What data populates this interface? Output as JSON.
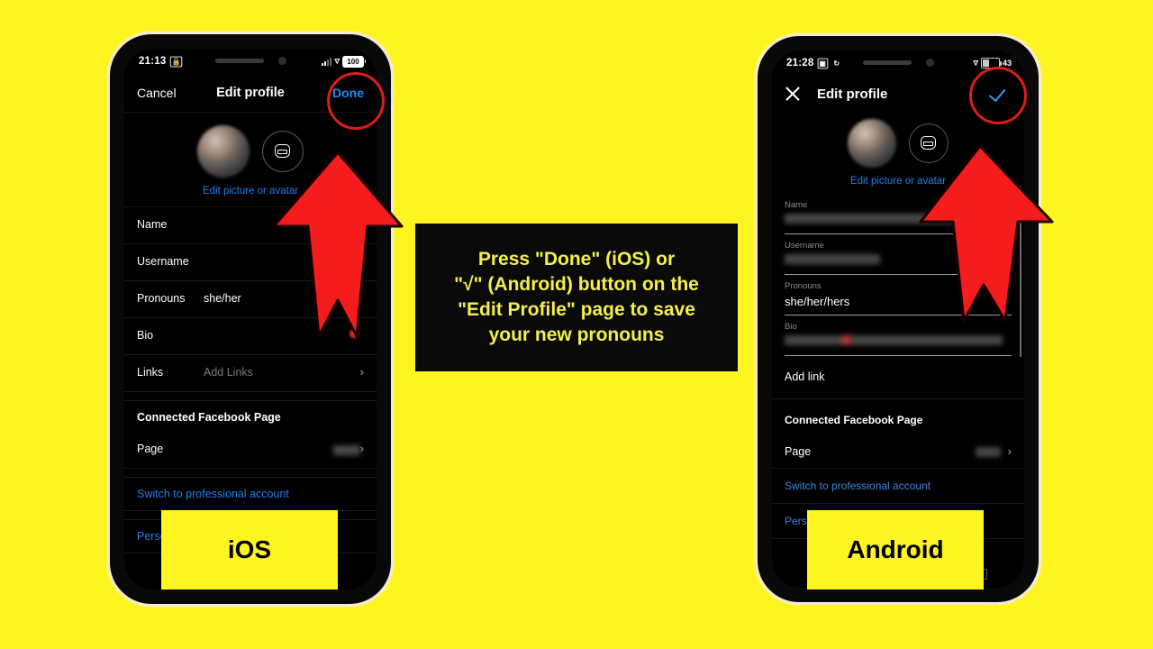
{
  "background_color": "#FDF420",
  "caption": {
    "text": "Press \"Done\" (iOS) or\n\"√\" (Android) button on the\n\"Edit Profile\" page to save\nyour new pronouns",
    "text_color": "#F5EF4A",
    "background_color": "#0A0A0A"
  },
  "annotation": {
    "highlight_color": "#E01B1B",
    "ios_highlight_target": "Done",
    "android_highlight_target": "checkmark"
  },
  "ios": {
    "platform_label": "iOS",
    "statusbar": {
      "time": "21:13",
      "lock_icon": "lock-icon",
      "signal_icon": "cellular-signal-icon",
      "wifi_icon": "wifi-icon",
      "battery": "100"
    },
    "navbar": {
      "cancel_label": "Cancel",
      "title": "Edit profile",
      "done_label": "Done",
      "done_color": "#1F8CF0"
    },
    "avatar": {
      "edit_link": "Edit picture or avatar",
      "avatar_button_icon": "avatar-face-icon"
    },
    "fields": [
      {
        "label": "Name",
        "value": "",
        "redacted": true,
        "type": "blur-wide"
      },
      {
        "label": "Username",
        "value": "",
        "redacted": true,
        "type": "blur-short"
      },
      {
        "label": "Pronouns",
        "value": "she/her",
        "redacted": false,
        "type": "text"
      },
      {
        "label": "Bio",
        "value": "",
        "redacted": true,
        "type": "blur-two-line"
      },
      {
        "label": "Links",
        "value": "Add Links",
        "redacted": false,
        "type": "placeholder-chevron"
      }
    ],
    "facebook_section": {
      "heading": "Connected Facebook Page",
      "row_label": "Page",
      "row_value": "",
      "row_redacted": true
    },
    "links": [
      "Switch to professional account",
      "Personal information settings"
    ],
    "link_color": "#1F7FE8"
  },
  "android": {
    "platform_label": "Android",
    "statusbar": {
      "time": "21:28",
      "icons": [
        "screen-record-icon",
        "sync-icon"
      ],
      "wifi_icon": "wifi-icon",
      "battery": "43"
    },
    "navbar": {
      "close_icon": "close-x-icon",
      "title": "Edit profile",
      "confirm_icon": "check-icon",
      "confirm_color": "#2E9BF0"
    },
    "avatar": {
      "edit_link": "Edit picture or avatar",
      "avatar_button_icon": "avatar-face-icon"
    },
    "fields": [
      {
        "label": "Name",
        "value": "",
        "redacted": true,
        "type": "blur-wide"
      },
      {
        "label": "Username",
        "value": "",
        "redacted": true,
        "type": "blur-short"
      },
      {
        "label": "Pronouns",
        "value": "she/her/hers",
        "redacted": false,
        "type": "text"
      },
      {
        "label": "Bio",
        "value": "",
        "redacted": true,
        "type": "blur-wide-dot"
      }
    ],
    "add_link_label": "Add link",
    "facebook_section": {
      "heading": "Connected Facebook Page",
      "row_label": "Page",
      "row_value": "",
      "row_redacted": true
    },
    "links": [
      "Switch to professional account",
      "Personal information settings"
    ],
    "link_color": "#3F86D8",
    "system_nav": [
      "back-triangle-icon",
      "home-circle-icon",
      "recents-square-icon"
    ]
  }
}
